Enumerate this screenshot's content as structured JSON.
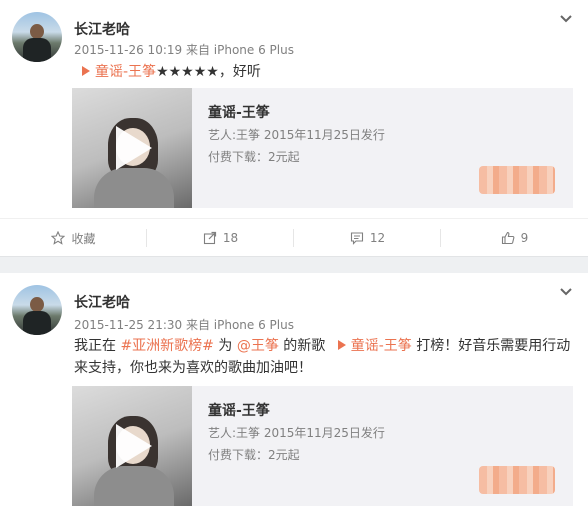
{
  "posts": [
    {
      "author": "长江老哈",
      "meta": "2015-11-26 10:19 来自 iPhone 6 Plus",
      "text": {
        "song_link": "童谣-王筝",
        "rest": "★★★★★，好听"
      },
      "card": {
        "title": "童谣-王筝",
        "artist": "艺人:王筝 2015年11月25日发行",
        "price": "付费下载：2元起"
      },
      "actions": {
        "favorite": "收藏",
        "repost": "18",
        "comment": "12",
        "like": "9"
      }
    },
    {
      "author": "长江老哈",
      "meta": "2015-11-25 21:30 来自 iPhone 6 Plus",
      "text": {
        "line1_a": "我正在",
        "hashtag": "#亚洲新歌榜#",
        "line1_b": "为",
        "mention": "@王筝",
        "line1_c": "的新歌",
        "song_link": "童谣-王筝",
        "line1_d": "打榜！好音乐需要用行动",
        "line2": "来支持，你也来为喜欢的歌曲加油吧！"
      },
      "card": {
        "title": "童谣-王筝",
        "artist": "艺人:王筝 2015年11月25日发行",
        "price": "付费下载：2元起"
      }
    }
  ],
  "colors": {
    "link": "#eb7350",
    "meta": "#808080",
    "separator": "#eef0f2"
  },
  "icons": [
    "chevron-down-icon",
    "star-icon",
    "repost-icon",
    "comment-icon",
    "thumbs-up-icon",
    "play-icon"
  ]
}
